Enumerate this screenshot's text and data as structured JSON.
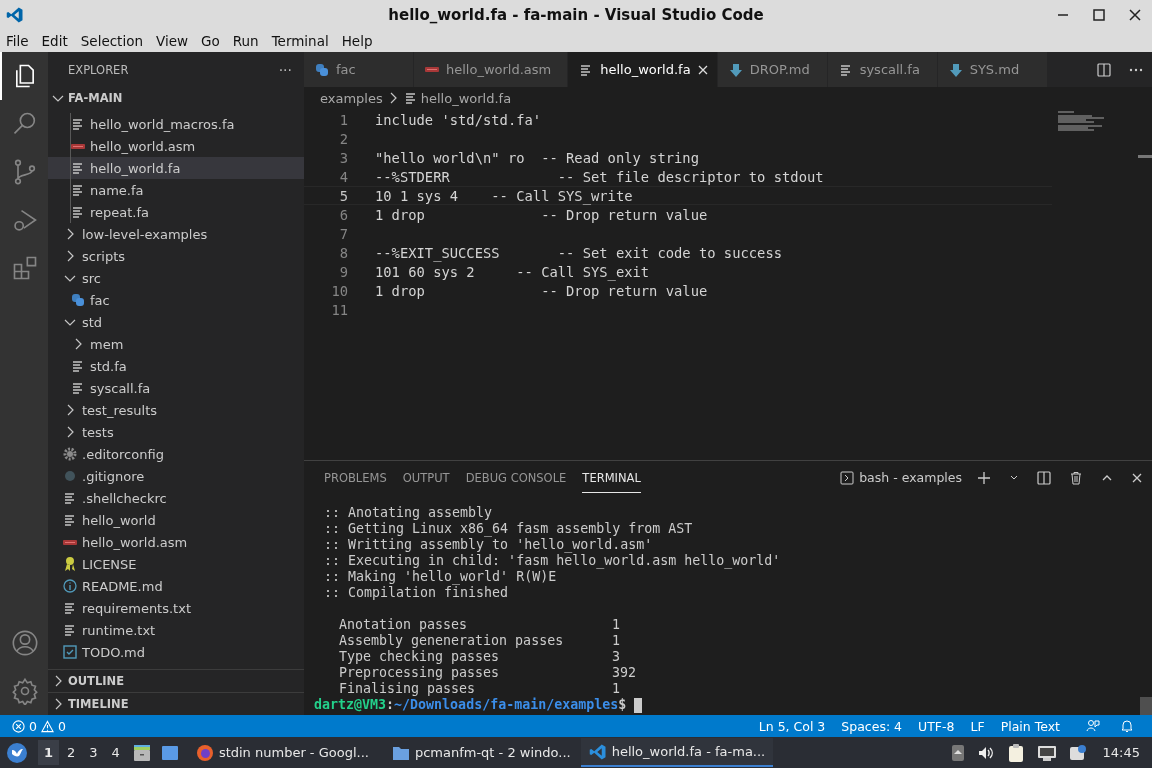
{
  "window": {
    "title": "hello_world.fa - fa-main - Visual Studio Code"
  },
  "menu": [
    "File",
    "Edit",
    "Selection",
    "View",
    "Go",
    "Run",
    "Terminal",
    "Help"
  ],
  "activity_bar": [
    {
      "kind": "files",
      "selected": true
    },
    {
      "kind": "search",
      "selected": false
    },
    {
      "kind": "source-control",
      "selected": false
    },
    {
      "kind": "run",
      "selected": false
    },
    {
      "kind": "extensions",
      "selected": false
    }
  ],
  "activity_bar_bottom": [
    {
      "kind": "account"
    },
    {
      "kind": "settings"
    }
  ],
  "explorer": {
    "title": "EXPLORER",
    "more": "···",
    "root": "FA-MAIN",
    "root_expanded": true,
    "tree": [
      {
        "children": [
          {
            "label": "hello_world_macros.fa",
            "kind": "text",
            "selected": false
          },
          {
            "label": "hello_world.asm",
            "kind": "asm",
            "selected": false
          },
          {
            "label": "hello_world.fa",
            "kind": "text",
            "selected": true
          },
          {
            "label": "name.fa",
            "kind": "text",
            "selected": false
          },
          {
            "label": "repeat.fa",
            "kind": "text",
            "selected": false
          }
        ]
      },
      {
        "label": "low-level-examples",
        "kind": "folder",
        "expanded": false,
        "selected": false
      },
      {
        "label": "scripts",
        "kind": "folder",
        "expanded": false,
        "selected": false
      },
      {
        "label": "src",
        "kind": "folder",
        "expanded": true,
        "selected": false,
        "children": [
          {
            "label": "fac",
            "kind": "python",
            "selected": false
          }
        ]
      },
      {
        "label": "std",
        "kind": "folder",
        "expanded": true,
        "selected": false,
        "children": [
          {
            "label": "mem",
            "kind": "folder",
            "expanded": false,
            "selected": false
          },
          {
            "label": "std.fa",
            "kind": "text",
            "selected": false
          },
          {
            "label": "syscall.fa",
            "kind": "text",
            "selected": false
          }
        ]
      },
      {
        "label": "test_results",
        "kind": "folder",
        "expanded": false,
        "selected": false
      },
      {
        "label": "tests",
        "kind": "folder",
        "expanded": false,
        "selected": false
      },
      {
        "label": ".editorconfig",
        "kind": "gear",
        "selected": false
      },
      {
        "label": ".gitignore",
        "kind": "git",
        "selected": false
      },
      {
        "label": ".shellcheckrc",
        "kind": "text",
        "selected": false
      },
      {
        "label": "hello_world",
        "kind": "text",
        "selected": false
      },
      {
        "label": "hello_world.asm",
        "kind": "asm",
        "selected": false
      },
      {
        "label": "LICENSE",
        "kind": "license",
        "selected": false
      },
      {
        "label": "README.md",
        "kind": "info",
        "selected": false
      },
      {
        "label": "requirements.txt",
        "kind": "text",
        "selected": false
      },
      {
        "label": "runtime.txt",
        "kind": "text",
        "selected": false
      },
      {
        "label": "TODO.md",
        "kind": "todo",
        "selected": false
      }
    ],
    "sections": [
      {
        "label": "OUTLINE",
        "expanded": false
      },
      {
        "label": "TIMELINE",
        "expanded": false
      }
    ]
  },
  "tabs": [
    {
      "label": "fac",
      "kind": "python",
      "selected": false
    },
    {
      "label": "hello_world.asm",
      "kind": "asm",
      "selected": false
    },
    {
      "label": "hello_world.fa",
      "kind": "text",
      "selected": true
    },
    {
      "label": "DROP.md",
      "kind": "markdown",
      "selected": false
    },
    {
      "label": "syscall.fa",
      "kind": "text",
      "selected": false
    },
    {
      "label": "SYS.md",
      "kind": "markdown",
      "selected": false
    }
  ],
  "breadcrumb": [
    {
      "label": "examples",
      "kind": "folder"
    },
    {
      "label": "hello_world.fa",
      "kind": "text"
    }
  ],
  "code": [
    {
      "number": "1",
      "text": "include 'std/std.fa'",
      "current": false
    },
    {
      "number": "2",
      "current": false
    },
    {
      "number": "3",
      "text": "\"hello world\\n\" ro  -- Read only string",
      "current": false
    },
    {
      "number": "4",
      "text": "--%STDERR             -- Set file descriptor to stdout",
      "current": false
    },
    {
      "number": "5",
      "text": "10 1 sys 4    -- Call SYS_write",
      "current": true
    },
    {
      "number": "6",
      "text": "1 drop              -- Drop return value",
      "current": false
    },
    {
      "number": "7",
      "current": false
    },
    {
      "number": "8",
      "text": "--%EXIT_SUCCESS       -- Set exit code to success",
      "current": false
    },
    {
      "number": "9",
      "text": "101 60 sys 2     -- Call SYS_exit",
      "current": false
    },
    {
      "number": "10",
      "text": "1 drop              -- Drop return value",
      "current": false
    },
    {
      "number": "11",
      "current": false
    }
  ],
  "panel": {
    "tabs": [
      {
        "label": "PROBLEMS",
        "selected": false
      },
      {
        "label": "OUTPUT",
        "selected": false
      },
      {
        "label": "DEBUG CONSOLE",
        "selected": false
      },
      {
        "label": "TERMINAL",
        "selected": true
      }
    ],
    "terminal_name": "bash - examples",
    "log": [
      ":: Anotating assembly",
      ":: Getting Linux x86_64 fasm assembly from AST",
      ":: Writting assembly to 'hello_world.asm'",
      ":: Executing in child: 'fasm hello_world.asm hello_world'",
      ":: Making 'hello_world' R(W)E",
      ":: Compilation finished"
    ],
    "stats": [
      {
        "label": "Anotation passes",
        "value": "1"
      },
      {
        "label": "Assembly geneneration passes",
        "value": "1"
      },
      {
        "label": "Type checking passes",
        "value": "3"
      },
      {
        "label": "Preprocessing passes",
        "value": "392"
      },
      {
        "label": "Finalising passes",
        "value": "1"
      }
    ],
    "prompt": {
      "user": "dartz@VM3",
      "separator": ":",
      "path": "~/Downloads/fa-main/examples",
      "symbol": "$"
    }
  },
  "status_bar": {
    "errors": "0",
    "warnings": "0",
    "items": [
      "Ln 5, Col 3",
      "Spaces: 4",
      "UTF-8",
      "LF",
      "Plain Text"
    ]
  },
  "taskbar": {
    "workspaces": [
      {
        "label": "1",
        "selected": true
      },
      {
        "label": "2",
        "selected": false
      },
      {
        "label": "3",
        "selected": false
      },
      {
        "label": "4",
        "selected": false
      }
    ],
    "windows": [
      {
        "title": "stdin number - Googl...",
        "kind": "browser",
        "selected": false
      },
      {
        "title": "pcmanfm-qt - 2 windo...",
        "kind": "folder",
        "selected": false
      },
      {
        "title": "hello_world.fa - fa-ma...",
        "kind": "editor",
        "selected": true
      }
    ],
    "clock": "14:45"
  }
}
